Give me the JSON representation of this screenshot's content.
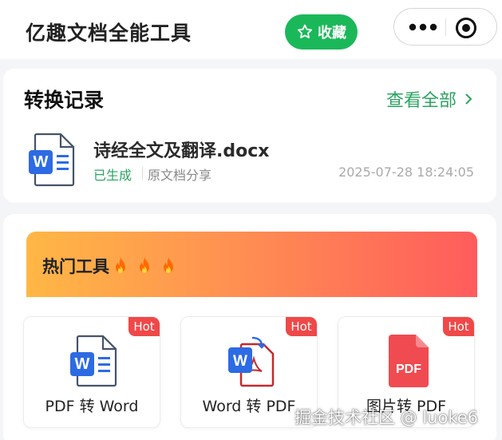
{
  "header": {
    "app_title": "亿趣文档全能工具",
    "favorite_label": "收藏",
    "accent_color": "#1bb85a"
  },
  "records": {
    "section_title": "转换记录",
    "view_all_label": "查看全部",
    "items": [
      {
        "file_name": "诗经全文及翻译.docx",
        "status": "已生成",
        "source": "原文档分享",
        "timestamp": "2025-07-28 18:24:05",
        "icon": "word-file-icon"
      }
    ]
  },
  "tools": {
    "section_title": "热门工具",
    "flames": [
      "🔥",
      "🔥",
      "🔥"
    ],
    "items": [
      {
        "label": "PDF 转 Word",
        "badge": "Hot",
        "icon": "word-file-icon"
      },
      {
        "label": "Word 转 PDF",
        "badge": "Hot",
        "icon": "word-to-pdf-icon"
      },
      {
        "label": "图片转 PDF",
        "badge": "Hot",
        "icon": "pdf-file-icon"
      }
    ]
  },
  "watermark": "掘金技术社区 @ luoke6"
}
